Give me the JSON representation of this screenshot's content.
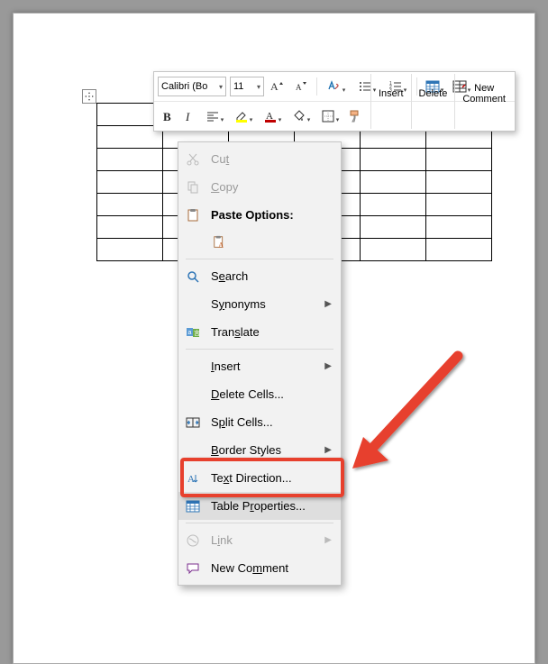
{
  "mini_toolbar": {
    "font_name": "Calibri (Bo",
    "font_size": "11",
    "insert_label": "Insert",
    "delete_label": "Delete",
    "new_comment_line1": "New",
    "new_comment_line2": "Comment"
  },
  "context_menu": {
    "cut": "Cut",
    "copy": "Copy",
    "paste_options": "Paste Options:",
    "search": "Search",
    "synonyms": "Synonyms",
    "translate": "Translate",
    "insert": "Insert",
    "delete_cells": "Delete Cells...",
    "split_cells": "Split Cells...",
    "border_styles": "Border Styles",
    "text_direction": "Text Direction...",
    "table_properties": "Table Properties...",
    "link": "Link",
    "new_comment": "New Comment"
  },
  "colors": {
    "callout": "#e7402d"
  }
}
